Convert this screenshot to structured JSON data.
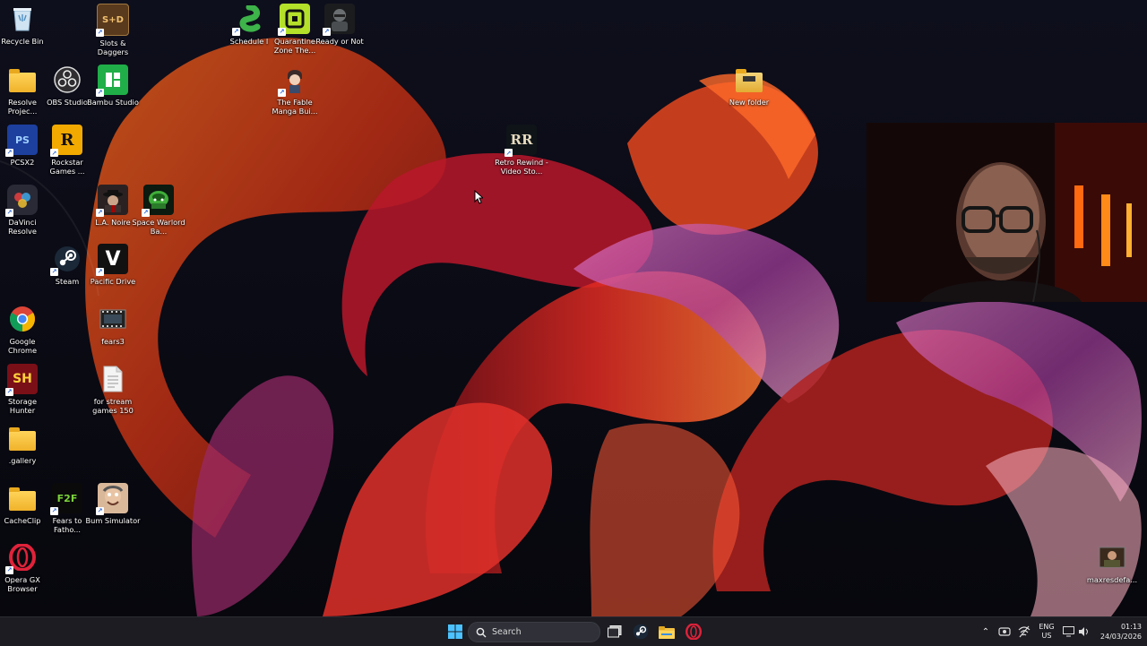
{
  "desktop": {
    "icons": [
      {
        "label": "Recycle Bin",
        "icon": "recycle-bin-icon"
      },
      {
        "label": "Resolve Projec...",
        "icon": "folder-icon"
      },
      {
        "label": "PCSX2",
        "icon": "pcsx2-icon"
      },
      {
        "label": "DaVinci Resolve",
        "icon": "davinci-resolve-icon"
      },
      {
        "label": "Google Chrome",
        "icon": "chrome-icon"
      },
      {
        "label": "Storage Hunter",
        "icon": "storage-hunter-icon"
      },
      {
        "label": ".gallery",
        "icon": "folder-icon"
      },
      {
        "label": "CacheClip",
        "icon": "folder-icon"
      },
      {
        "label": "Opera GX Browser",
        "icon": "opera-gx-icon"
      },
      {
        "label": "OBS Studio",
        "icon": "obs-icon"
      },
      {
        "label": "Rockstar Games ...",
        "icon": "rockstar-icon"
      },
      {
        "label": "Steam",
        "icon": "steam-icon"
      },
      {
        "label": "Fears to Fatho...",
        "icon": "fears-to-fathom-icon"
      },
      {
        "label": "Slots & Daggers",
        "icon": "slots-daggers-icon"
      },
      {
        "label": "Bambu Studio",
        "icon": "bambu-studio-icon"
      },
      {
        "label": "L.A. Noire",
        "icon": "la-noire-icon"
      },
      {
        "label": "Pacific Drive",
        "icon": "pacific-drive-icon"
      },
      {
        "label": "fears3",
        "icon": "video-file-icon"
      },
      {
        "label": "for stream games 150",
        "icon": "text-file-icon"
      },
      {
        "label": "Bum Simulator",
        "icon": "bum-simulator-icon"
      },
      {
        "label": "Space Warlord Ba...",
        "icon": "space-warlord-icon"
      },
      {
        "label": "Schedule I",
        "icon": "schedule-i-icon"
      },
      {
        "label": "Quarantine Zone The...",
        "icon": "quarantine-zone-icon"
      },
      {
        "label": "Ready or Not",
        "icon": "ready-or-not-icon"
      },
      {
        "label": "The Fable Manga Bui...",
        "icon": "fable-manga-icon"
      },
      {
        "label": "Retro Rewind - Video Sto...",
        "icon": "retro-rewind-icon"
      },
      {
        "label": "New folder",
        "icon": "folder-icon"
      },
      {
        "label": "maxresdefa...",
        "icon": "image-file-icon"
      }
    ],
    "glyphs": {
      "pcsx2": "PS",
      "rockstar": "R",
      "fears": "F2F",
      "slots": "S+D",
      "storage": "SH",
      "pacific": "V",
      "retro": "RR"
    }
  },
  "taskbar": {
    "search_placeholder": "Search",
    "language": "ENG",
    "region": "US",
    "time": "01:13",
    "date": "24/03/2026"
  },
  "colors": {
    "accent": "#0078d4",
    "wallpaper_red": "#d4201e",
    "wallpaper_orange": "#e0621c",
    "wallpaper_pink": "#c45aa8"
  }
}
